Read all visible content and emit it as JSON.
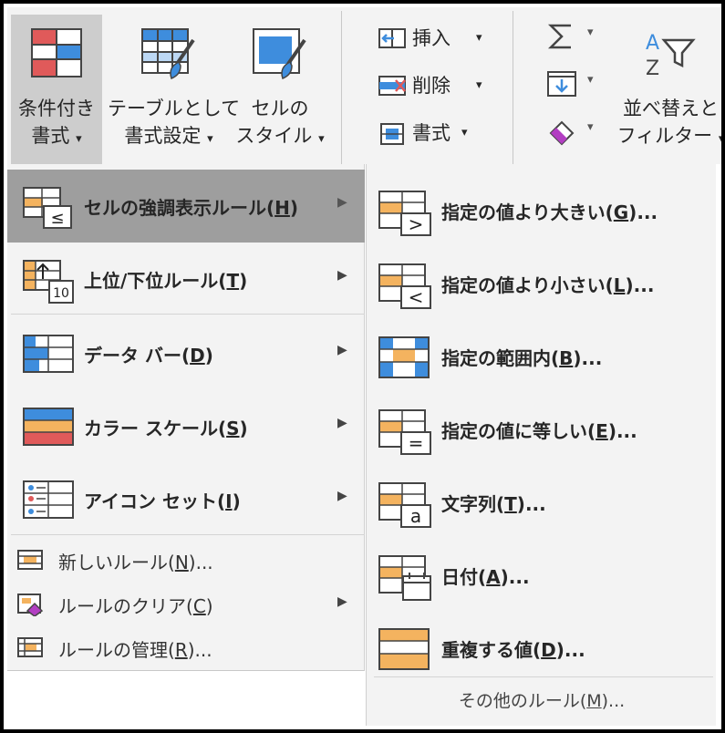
{
  "ribbon": {
    "conditional_format": {
      "line1": "条件付き",
      "line2": "書式",
      "caret": "▾"
    },
    "format_as_table": {
      "line1": "テーブルとして",
      "line2": "書式設定",
      "caret": "▾"
    },
    "cell_styles": {
      "line1": "セルの",
      "line2": "スタイル",
      "caret": "▾"
    },
    "insert": {
      "label": "挿入",
      "caret": "▾"
    },
    "delete": {
      "label": "削除",
      "caret": "▾"
    },
    "format": {
      "label": "書式",
      "caret": "▾"
    },
    "sum_caret": "▾",
    "fill_caret": "▾",
    "clear_caret": "▾",
    "sort_filter": {
      "line1": "並べ替えと",
      "line2": "フィルター",
      "caret": "▾"
    },
    "icons": {
      "sum": "sigma-icon",
      "sort": "sort-filter-icon"
    }
  },
  "menu": {
    "highlight": {
      "label": "セルの強調表示ルール(",
      "key": "H",
      "end": ")"
    },
    "topbottom": {
      "label": "上位/下位ルール(",
      "key": "T",
      "end": ")"
    },
    "databar": {
      "label": "データ バー(",
      "key": "D",
      "end": ")"
    },
    "colorscale": {
      "label": "カラー スケール(",
      "key": "S",
      "end": ")"
    },
    "iconset": {
      "label": "アイコン セット(",
      "key": "I",
      "end": ")"
    },
    "newrule": {
      "label": "新しいルール(",
      "key": "N",
      "end": ")..."
    },
    "clearrules": {
      "label": "ルールのクリア(",
      "key": "C",
      "end": ")"
    },
    "managerules": {
      "label": "ルールの管理(",
      "key": "R",
      "end": ")..."
    },
    "arrow": "▶",
    "topbottom_badge": "10"
  },
  "submenu": {
    "greater": {
      "label": "指定の値より大きい(",
      "key": "G",
      "end": ")..."
    },
    "less": {
      "label": "指定の値より小さい(",
      "key": "L",
      "end": ")..."
    },
    "between": {
      "label": "指定の範囲内(",
      "key": "B",
      "end": ")..."
    },
    "equal": {
      "label": "指定の値に等しい(",
      "key": "E",
      "end": ")..."
    },
    "text": {
      "label": "文字列(",
      "key": "T",
      "end": ")..."
    },
    "date": {
      "label": "日付(",
      "key": "A",
      "end": ")..."
    },
    "duplicate": {
      "label": "重複する値(",
      "key": "D",
      "end": ")..."
    },
    "more": {
      "label": "その他のルール(",
      "key": "M",
      "end": ")..."
    },
    "symbols": {
      "greater": ">",
      "less": "<",
      "equal": "=",
      "text": "a",
      "le": "≤"
    }
  },
  "colors": {
    "ribbon_bg": "#f3f3f3",
    "highlight_bg": "#9e9e9e",
    "orange": "#f4b35f",
    "blue": "#3e8ddd",
    "red": "#e05a5a"
  }
}
